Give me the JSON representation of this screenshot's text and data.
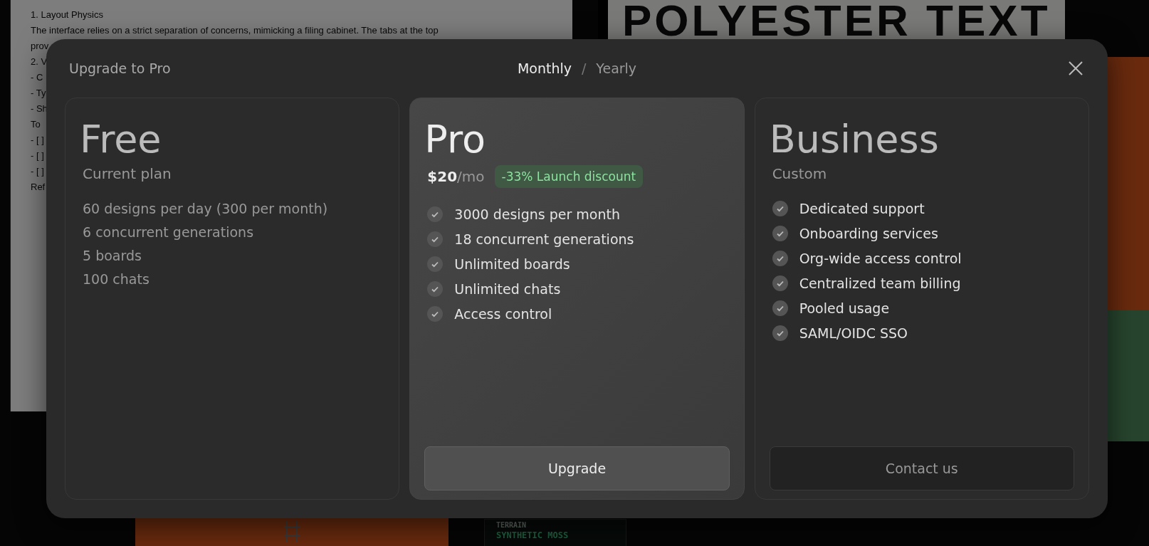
{
  "background": {
    "document": {
      "heading": "1. Layout Physics",
      "paragraph": "The interface relies on a strict separation of concerns, mimicking a filing cabinet. The tabs at the top",
      "sections": [
        [
          "prov"
        ],
        [
          "2. V",
          "- C",
          "- Ty",
          "- Sh"
        ],
        [
          "To",
          "- [ ]",
          "- [ ]",
          "- [ ]"
        ],
        [
          "Ref"
        ]
      ]
    },
    "poster_title": "POLYESTER TEXT",
    "terrain_card": {
      "label": "TERRAIN",
      "value": "SYNTHETIC MOSS"
    }
  },
  "dialog": {
    "title": "Upgrade to Pro",
    "tab_separator": "/",
    "billing_tabs": [
      {
        "label": "Monthly",
        "selected": true
      },
      {
        "label": "Yearly",
        "selected": false
      }
    ],
    "plans": [
      {
        "name": "Free",
        "highlighted": false,
        "subtitle": "Current plan",
        "check_icons": false,
        "features": [
          "60 designs per day (300 per month)",
          "6 concurrent generations",
          "5 boards",
          "100 chats"
        ]
      },
      {
        "name": "Pro",
        "highlighted": true,
        "price": "$20",
        "unit": "/mo",
        "badge": "-33% Launch discount",
        "check_icons": true,
        "features": [
          "3000 designs per month",
          "18 concurrent generations",
          "Unlimited boards",
          "Unlimited chats",
          "Access control"
        ],
        "button": {
          "label": "Upgrade",
          "kind": "primary"
        }
      },
      {
        "name": "Business",
        "highlighted": false,
        "subtitle": "Custom",
        "check_icons": true,
        "features": [
          "Dedicated support",
          "Onboarding services",
          "Org-wide access control",
          "Centralized team billing",
          "Pooled usage",
          "SAML/OIDC SSO"
        ],
        "button": {
          "label": "Contact us",
          "kind": "outline"
        }
      }
    ]
  }
}
